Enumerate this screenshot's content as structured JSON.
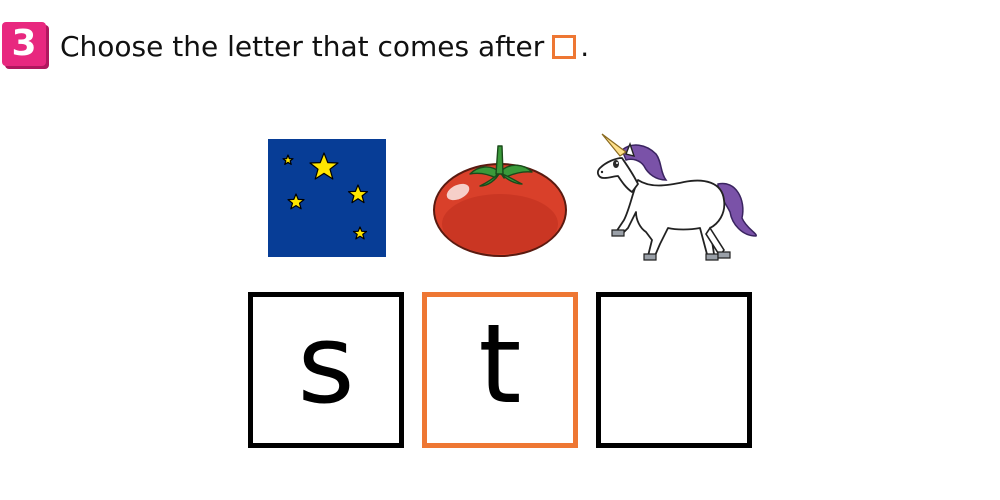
{
  "question": {
    "number": "3",
    "text": "Choose the letter that comes after",
    "suffix": ".",
    "highlight_color": "#ee7733",
    "badge_color": "#e8287f"
  },
  "pictures": [
    {
      "name": "stars",
      "icon": "stars-night-sky-icon"
    },
    {
      "name": "tomato",
      "icon": "tomato-icon"
    },
    {
      "name": "unicorn",
      "icon": "unicorn-icon"
    }
  ],
  "letter_boxes": [
    {
      "letter": "s",
      "highlighted": false
    },
    {
      "letter": "t",
      "highlighted": true
    },
    {
      "letter": "",
      "highlighted": false
    }
  ]
}
